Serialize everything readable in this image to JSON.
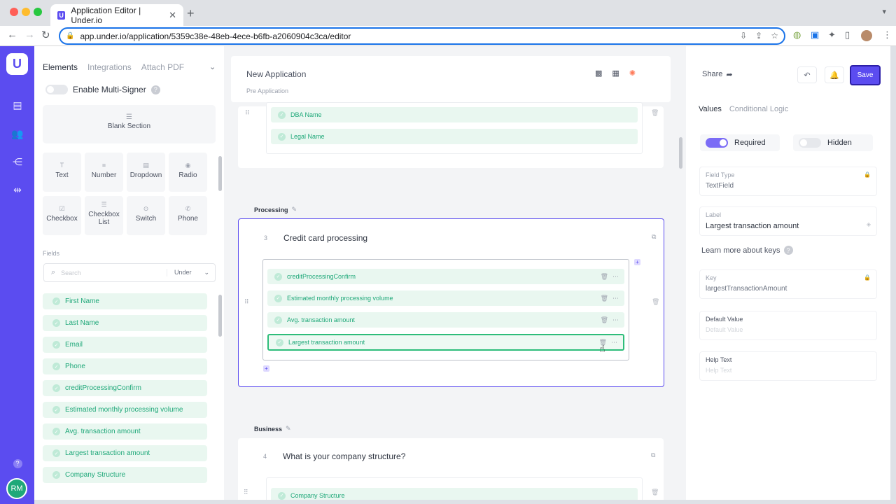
{
  "browser": {
    "tab_title": "Application Editor | Under.io",
    "tab_favicon": "U",
    "url": "app.under.io/application/5359c38e-48eb-4ece-b6fb-a2060904c3ca/editor"
  },
  "rail": {
    "logo": "U",
    "icons": [
      "document-icon",
      "users-icon",
      "share-icon",
      "arrows-icon"
    ],
    "help": "?",
    "avatar": "RM"
  },
  "left": {
    "tabs": [
      "Elements",
      "Integrations",
      "Attach PDF"
    ],
    "multi_signer_label": "Enable Multi-Signer",
    "blank_section": "Blank Section",
    "elements": [
      {
        "label": "Text",
        "icon": "T"
      },
      {
        "label": "Number",
        "icon": "≡"
      },
      {
        "label": "Dropdown",
        "icon": "▤"
      },
      {
        "label": "Radio",
        "icon": "◉"
      },
      {
        "label": "Checkbox",
        "icon": "☑"
      },
      {
        "label": "Checkbox List",
        "icon": "☰"
      },
      {
        "label": "Switch",
        "icon": "⊙"
      },
      {
        "label": "Phone",
        "icon": "✆"
      }
    ],
    "fields_label": "Fields",
    "search_placeholder": "Search",
    "search_scope": "Under",
    "fields": [
      "First Name",
      "Last Name",
      "Email",
      "Phone",
      "creditProcessingConfirm",
      "Estimated monthly processing volume",
      "Avg. transaction amount",
      "Largest transaction amount",
      "Company Structure"
    ]
  },
  "center": {
    "app_title": "New Application",
    "app_subtitle": "Pre Application",
    "top_card_rows": [
      "DBA Name",
      "Legal Name"
    ],
    "section1": {
      "label": "Processing",
      "number": "3",
      "question": "Credit card processing",
      "rows": [
        "creditProcessingConfirm",
        "Estimated monthly processing volume",
        "Avg. transaction amount",
        "Largest transaction amount"
      ]
    },
    "section2": {
      "label": "Business",
      "number": "4",
      "question": "What is your company structure?",
      "rows": [
        "Company Structure"
      ]
    }
  },
  "right": {
    "share_label": "Share",
    "save_label": "Save",
    "tabs": [
      "Values",
      "Conditional Logic"
    ],
    "required_label": "Required",
    "hidden_label": "Hidden",
    "field_type_label": "Field Type",
    "field_type_value": "TextField",
    "label_label": "Label",
    "label_value": "Largest transaction amount",
    "learn_more": "Learn more about keys",
    "key_label": "Key",
    "key_value": "largestTransactionAmount",
    "default_label": "Default Value",
    "default_placeholder": "Default Value",
    "help_label": "Help Text",
    "help_placeholder": "Help Text"
  },
  "colors": {
    "brand": "#5b4cf0",
    "field_green": "#1fa879",
    "field_bg": "#e9f7f0",
    "canvas_bg": "#f3f4f6"
  }
}
